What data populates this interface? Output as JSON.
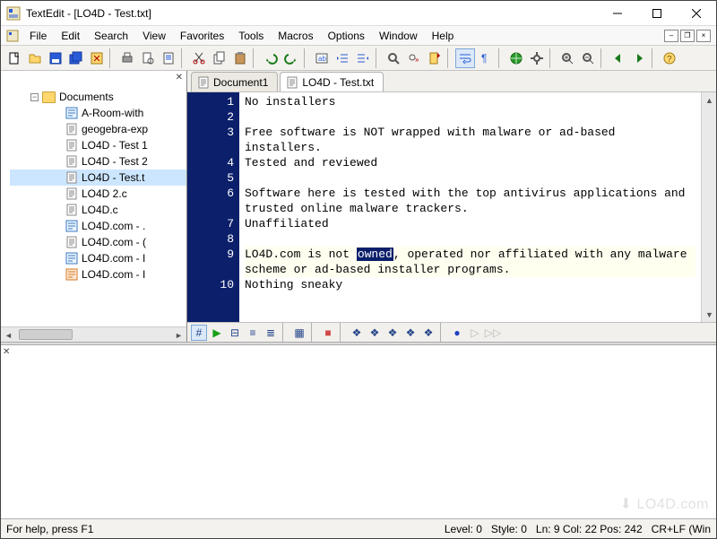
{
  "colors": {
    "gutter_bg": "#0b1f6b",
    "gutter_fg": "#ffffff",
    "selection_bg": "#0b1f6b",
    "selection_fg": "#ffffff",
    "accent": "#cde6ff"
  },
  "window": {
    "title": "TextEdit - [LO4D - Test.txt]"
  },
  "menu": [
    "File",
    "Edit",
    "Search",
    "View",
    "Favorites",
    "Tools",
    "Macros",
    "Options",
    "Window",
    "Help"
  ],
  "toolbar": [
    {
      "name": "new-file-icon"
    },
    {
      "name": "open-file-icon"
    },
    {
      "name": "save-icon"
    },
    {
      "name": "save-all-icon"
    },
    {
      "name": "close-file-icon"
    },
    {
      "name": "sep"
    },
    {
      "name": "print-icon"
    },
    {
      "name": "print-preview-icon"
    },
    {
      "name": "page-setup-icon"
    },
    {
      "name": "sep"
    },
    {
      "name": "cut-icon"
    },
    {
      "name": "copy-icon"
    },
    {
      "name": "paste-icon"
    },
    {
      "name": "sep"
    },
    {
      "name": "undo-icon"
    },
    {
      "name": "redo-icon"
    },
    {
      "name": "sep"
    },
    {
      "name": "insert-text-icon"
    },
    {
      "name": "indent-left-icon"
    },
    {
      "name": "indent-right-icon"
    },
    {
      "name": "sep"
    },
    {
      "name": "find-icon"
    },
    {
      "name": "find-next-icon"
    },
    {
      "name": "bookmarks-icon"
    },
    {
      "name": "sep"
    },
    {
      "name": "word-wrap-icon",
      "active": true
    },
    {
      "name": "show-whitespace-icon"
    },
    {
      "name": "sep"
    },
    {
      "name": "web-icon"
    },
    {
      "name": "tools-icon"
    },
    {
      "name": "sep"
    },
    {
      "name": "zoom-in-icon"
    },
    {
      "name": "zoom-out-icon"
    },
    {
      "name": "sep"
    },
    {
      "name": "nav-back-icon"
    },
    {
      "name": "nav-forward-icon"
    },
    {
      "name": "sep"
    },
    {
      "name": "help-icon"
    }
  ],
  "sidebar": {
    "root_label": "Documents",
    "items": [
      {
        "label": "A-Room-with",
        "type": "doc"
      },
      {
        "label": "geogebra-exp",
        "type": "txt"
      },
      {
        "label": "LO4D - Test 1",
        "type": "txt"
      },
      {
        "label": "LO4D - Test 2",
        "type": "txt"
      },
      {
        "label": "LO4D - Test.t",
        "type": "txt",
        "selected": true
      },
      {
        "label": "LO4D 2.c",
        "type": "txt"
      },
      {
        "label": "LO4D.c",
        "type": "txt"
      },
      {
        "label": "LO4D.com - .",
        "type": "doc"
      },
      {
        "label": "LO4D.com - (",
        "type": "txt"
      },
      {
        "label": "LO4D.com - I",
        "type": "doc"
      },
      {
        "label": "LO4D.com - I",
        "type": "html"
      }
    ]
  },
  "tabs": [
    {
      "label": "Document1",
      "active": false
    },
    {
      "label": "LO4D - Test.txt",
      "active": true
    }
  ],
  "editor": {
    "gutter": [
      "1",
      "2",
      "3",
      "",
      "4",
      "5",
      "6",
      "",
      "7",
      "8",
      "9",
      "",
      "10"
    ],
    "lines": [
      {
        "n": 1,
        "text": "No installers"
      },
      {
        "n": 2,
        "text": ""
      },
      {
        "n": 3,
        "text": "Free software is NOT wrapped with malware or ad-based installers."
      },
      {
        "n": 4,
        "text": "Tested and reviewed"
      },
      {
        "n": 5,
        "text": ""
      },
      {
        "n": 6,
        "text": "Software here is tested with the top antivirus applications and trusted online malware trackers."
      },
      {
        "n": 7,
        "text": "Unaffiliated"
      },
      {
        "n": 8,
        "text": ""
      },
      {
        "n": 9,
        "highlight": true,
        "pre": "LO4D.com is not ",
        "sel": "owned",
        "post": ", operated nor affiliated with any malware scheme or ad-based installer programs."
      },
      {
        "n": 10,
        "text": "Nothing sneaky"
      }
    ]
  },
  "editor_toolbar": [
    {
      "name": "toggle-line-numbers-icon",
      "glyph": "#",
      "active": true
    },
    {
      "name": "run-macro-icon",
      "glyph": "▶",
      "color": "#18a018"
    },
    {
      "name": "fold-all-icon",
      "glyph": "⊟"
    },
    {
      "name": "fold-icon",
      "glyph": "≡"
    },
    {
      "name": "unfold-icon",
      "glyph": "≣"
    },
    {
      "name": "sep"
    },
    {
      "name": "block-select-icon",
      "glyph": "▦"
    },
    {
      "name": "sep"
    },
    {
      "name": "color-swatch-icon",
      "glyph": "■",
      "color": "#d04848"
    },
    {
      "name": "sep"
    },
    {
      "name": "bookmark-toggle-icon",
      "glyph": "❖"
    },
    {
      "name": "bookmark-prev-icon",
      "glyph": "❖"
    },
    {
      "name": "bookmark-next-icon",
      "glyph": "❖"
    },
    {
      "name": "bookmark-clear-icon",
      "glyph": "❖"
    },
    {
      "name": "bookmark-list-icon",
      "glyph": "❖"
    },
    {
      "name": "sep"
    },
    {
      "name": "record-macro-icon",
      "glyph": "●",
      "color": "#2040c0"
    },
    {
      "name": "play-macro-icon",
      "glyph": "▷",
      "color": "#b8b8b8"
    },
    {
      "name": "fast-forward-icon",
      "glyph": "▷▷",
      "color": "#b8b8b8"
    }
  ],
  "status": {
    "help": "For help, press F1",
    "level": "Level: 0",
    "style": "Style: 0",
    "pos": "Ln: 9 Col: 22 Pos: 242",
    "eol": "CR+LF (Win   "
  },
  "watermark": "⬇ LO4D.com"
}
